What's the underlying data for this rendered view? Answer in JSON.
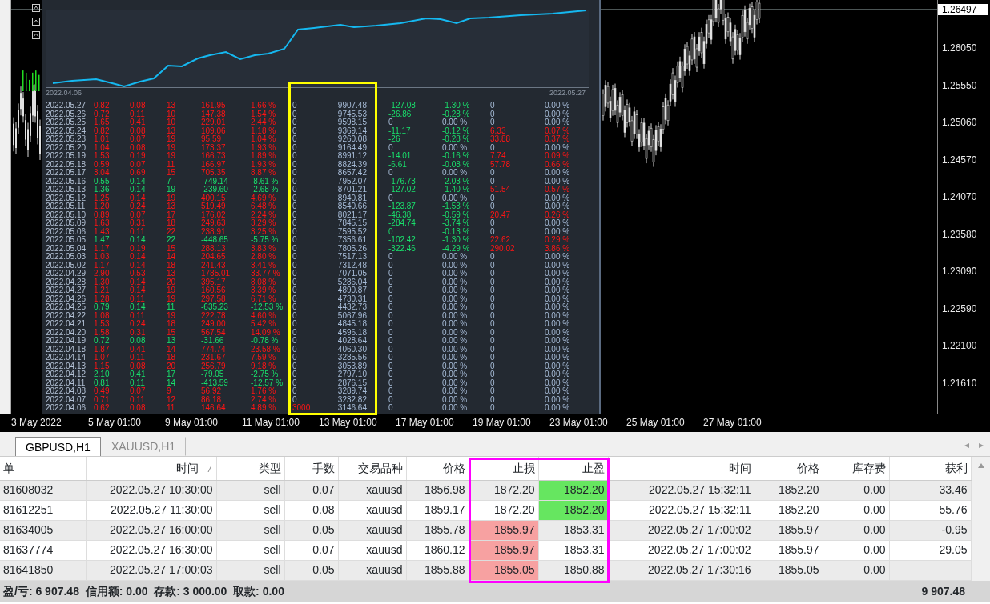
{
  "report": {
    "start_date": "2022.04.06",
    "end_date": "2022.05.27",
    "rows": [
      {
        "cells": [
          "2022.05.27",
          "0.82",
          "0.08",
          "13",
          "161.95",
          "1.66 %",
          "0",
          "9907.48",
          "-127.08",
          "-1.30 %",
          "0",
          "0.00 %"
        ],
        "loss": false,
        "c6_hi": false,
        "c8_hi": true,
        "c10_hi": false
      },
      {
        "cells": [
          "2022.05.26",
          "0.72",
          "0.11",
          "10",
          "147.38",
          "1.54 %",
          "0",
          "9745.53",
          "-26.86",
          "-0.28 %",
          "0",
          "0.00 %"
        ],
        "loss": false,
        "c6_hi": false,
        "c8_hi": true,
        "c10_hi": false
      },
      {
        "cells": [
          "2022.05.25",
          "1.65",
          "0.41",
          "10",
          "229.01",
          "2.44 %",
          "0",
          "9598.15",
          "0",
          "0.00 %",
          "0",
          "0.00 %"
        ],
        "loss": false,
        "c6_hi": false,
        "c8_hi": false,
        "c10_hi": false
      },
      {
        "cells": [
          "2022.05.24",
          "0.82",
          "0.08",
          "13",
          "109.06",
          "1.18 %",
          "0",
          "9369.14",
          "-11.17",
          "-0.12 %",
          "6.33",
          "0.07 %"
        ],
        "loss": false,
        "c6_hi": false,
        "c8_hi": true,
        "c10_hi": true
      },
      {
        "cells": [
          "2022.05.23",
          "1.01",
          "0.07",
          "19",
          "95.59",
          "1.04 %",
          "0",
          "9260.08",
          "-26",
          "-0.28 %",
          "33.88",
          "0.37 %"
        ],
        "loss": false,
        "c6_hi": false,
        "c8_hi": true,
        "c10_hi": true
      },
      {
        "cells": [
          "2022.05.20",
          "1.04",
          "0.08",
          "19",
          "173.37",
          "1.93 %",
          "0",
          "9164.49",
          "0",
          "0.00 %",
          "0",
          "0.00 %"
        ],
        "loss": false,
        "c6_hi": false,
        "c8_hi": false,
        "c10_hi": false
      },
      {
        "cells": [
          "2022.05.19",
          "1.53",
          "0.19",
          "19",
          "166.73",
          "1.89 %",
          "0",
          "8991.12",
          "-14.01",
          "-0.16 %",
          "7.74",
          "0.09 %"
        ],
        "loss": false,
        "c6_hi": false,
        "c8_hi": true,
        "c10_hi": true
      },
      {
        "cells": [
          "2022.05.18",
          "0.59",
          "0.07",
          "11",
          "166.97",
          "1.93 %",
          "0",
          "8824.39",
          "-6.61",
          "-0.08 %",
          "57.78",
          "0.66 %"
        ],
        "loss": false,
        "c6_hi": false,
        "c8_hi": true,
        "c10_hi": true
      },
      {
        "cells": [
          "2022.05.17",
          "3.04",
          "0.69",
          "15",
          "705.35",
          "8.87 %",
          "0",
          "8657.42",
          "0",
          "0.00 %",
          "0",
          "0.00 %"
        ],
        "loss": false,
        "c6_hi": false,
        "c8_hi": false,
        "c10_hi": false
      },
      {
        "cells": [
          "2022.05.16",
          "0.55",
          "0.14",
          "7",
          "-749.14",
          "-8.61 %",
          "0",
          "7952.07",
          "-176.73",
          "-2.03 %",
          "0",
          "0.00 %"
        ],
        "loss": true,
        "c6_hi": false,
        "c8_hi": true,
        "c10_hi": false
      },
      {
        "cells": [
          "2022.05.13",
          "1.36",
          "0.14",
          "19",
          "-239.60",
          "-2.68 %",
          "0",
          "8701.21",
          "-127.02",
          "-1.40 %",
          "51.54",
          "0.57 %"
        ],
        "loss": true,
        "c6_hi": false,
        "c8_hi": true,
        "c10_hi": true
      },
      {
        "cells": [
          "2022.05.12",
          "1.25",
          "0.14",
          "19",
          "400.15",
          "4.69 %",
          "0",
          "8940.81",
          "0",
          "0.00 %",
          "0",
          "0.00 %"
        ],
        "loss": false,
        "c6_hi": false,
        "c8_hi": false,
        "c10_hi": false
      },
      {
        "cells": [
          "2022.05.11",
          "1.20",
          "0.24",
          "13",
          "519.49",
          "6.48 %",
          "0",
          "8540.66",
          "-123.87",
          "-1.53 %",
          "0",
          "0.00 %"
        ],
        "loss": false,
        "c6_hi": false,
        "c8_hi": true,
        "c10_hi": false
      },
      {
        "cells": [
          "2022.05.10",
          "0.89",
          "0.07",
          "17",
          "176.02",
          "2.24 %",
          "0",
          "8021.17",
          "-46.38",
          "-0.59 %",
          "20.47",
          "0.26 %"
        ],
        "loss": false,
        "c6_hi": false,
        "c8_hi": true,
        "c10_hi": true
      },
      {
        "cells": [
          "2022.05.09",
          "1.63",
          "0.31",
          "18",
          "249.63",
          "3.29 %",
          "0",
          "7845.15",
          "-284.74",
          "-3.74 %",
          "0",
          "0.00 %"
        ],
        "loss": false,
        "c6_hi": false,
        "c8_hi": true,
        "c10_hi": false
      },
      {
        "cells": [
          "2022.05.06",
          "1.43",
          "0.11",
          "22",
          "238.91",
          "3.25 %",
          "0",
          "7595.52",
          "0",
          "-0.13 %",
          "0",
          "0.00 %"
        ],
        "loss": false,
        "c6_hi": false,
        "c8_hi": true,
        "c10_hi": false
      },
      {
        "cells": [
          "2022.05.05",
          "1.47",
          "0.14",
          "22",
          "-448.65",
          "-5.75 %",
          "0",
          "7356.61",
          "-102.42",
          "-1.30 %",
          "22.62",
          "0.29 %"
        ],
        "loss": true,
        "c6_hi": false,
        "c8_hi": true,
        "c10_hi": true
      },
      {
        "cells": [
          "2022.05.04",
          "1.17",
          "0.19",
          "15",
          "288.13",
          "3.83 %",
          "0",
          "7805.26",
          "-322.46",
          "-4.29 %",
          "290.02",
          "3.86 %"
        ],
        "loss": false,
        "c6_hi": false,
        "c8_hi": true,
        "c10_hi": true
      },
      {
        "cells": [
          "2022.05.03",
          "1.03",
          "0.14",
          "14",
          "204.65",
          "2.80 %",
          "0",
          "7517.13",
          "0",
          "0.00 %",
          "0",
          "0.00 %"
        ],
        "loss": false,
        "c6_hi": false,
        "c8_hi": false,
        "c10_hi": false
      },
      {
        "cells": [
          "2022.05.02",
          "1.17",
          "0.14",
          "18",
          "241.43",
          "3.41 %",
          "0",
          "7312.48",
          "0",
          "0.00 %",
          "0",
          "0.00 %"
        ],
        "loss": false,
        "c6_hi": false,
        "c8_hi": false,
        "c10_hi": false
      },
      {
        "cells": [
          "2022.04.29",
          "2.90",
          "0.53",
          "13",
          "1785.01",
          "33.77 %",
          "0",
          "7071.05",
          "0",
          "0.00 %",
          "0",
          "0.00 %"
        ],
        "loss": false,
        "c6_hi": false,
        "c8_hi": false,
        "c10_hi": false
      },
      {
        "cells": [
          "2022.04.28",
          "1.30",
          "0.14",
          "20",
          "395.17",
          "8.08 %",
          "0",
          "5286.04",
          "0",
          "0.00 %",
          "0",
          "0.00 %"
        ],
        "loss": false,
        "c6_hi": false,
        "c8_hi": false,
        "c10_hi": false
      },
      {
        "cells": [
          "2022.04.27",
          "1.21",
          "0.14",
          "19",
          "160.56",
          "3.39 %",
          "0",
          "4890.87",
          "0",
          "0.00 %",
          "0",
          "0.00 %"
        ],
        "loss": false,
        "c6_hi": false,
        "c8_hi": false,
        "c10_hi": false
      },
      {
        "cells": [
          "2022.04.26",
          "1.28",
          "0.11",
          "19",
          "297.58",
          "6.71 %",
          "0",
          "4730.31",
          "0",
          "0.00 %",
          "0",
          "0.00 %"
        ],
        "loss": false,
        "c6_hi": false,
        "c8_hi": false,
        "c10_hi": false
      },
      {
        "cells": [
          "2022.04.25",
          "0.79",
          "0.14",
          "11",
          "-635.23",
          "-12.53 %",
          "0",
          "4432.73",
          "0",
          "0.00 %",
          "0",
          "0.00 %"
        ],
        "loss": true,
        "c6_hi": false,
        "c8_hi": false,
        "c10_hi": false
      },
      {
        "cells": [
          "2022.04.22",
          "1.08",
          "0.11",
          "19",
          "222.78",
          "4.60 %",
          "0",
          "5067.96",
          "0",
          "0.00 %",
          "0",
          "0.00 %"
        ],
        "loss": false,
        "c6_hi": false,
        "c8_hi": false,
        "c10_hi": false
      },
      {
        "cells": [
          "2022.04.21",
          "1.53",
          "0.24",
          "18",
          "249.00",
          "5.42 %",
          "0",
          "4845.18",
          "0",
          "0.00 %",
          "0",
          "0.00 %"
        ],
        "loss": false,
        "c6_hi": false,
        "c8_hi": false,
        "c10_hi": false
      },
      {
        "cells": [
          "2022.04.20",
          "1.58",
          "0.31",
          "15",
          "567.54",
          "14.09 %",
          "0",
          "4596.18",
          "0",
          "0.00 %",
          "0",
          "0.00 %"
        ],
        "loss": false,
        "c6_hi": false,
        "c8_hi": false,
        "c10_hi": false
      },
      {
        "cells": [
          "2022.04.19",
          "0.72",
          "0.08",
          "13",
          "-31.66",
          "-0.78 %",
          "0",
          "4028.64",
          "0",
          "0.00 %",
          "0",
          "0.00 %"
        ],
        "loss": true,
        "c6_hi": false,
        "c8_hi": false,
        "c10_hi": false
      },
      {
        "cells": [
          "2022.04.18",
          "1.87",
          "0.41",
          "14",
          "774.74",
          "23.58 %",
          "0",
          "4060.30",
          "0",
          "0.00 %",
          "0",
          "0.00 %"
        ],
        "loss": false,
        "c6_hi": false,
        "c8_hi": false,
        "c10_hi": false
      },
      {
        "cells": [
          "2022.04.14",
          "1.07",
          "0.11",
          "18",
          "231.67",
          "7.59 %",
          "0",
          "3285.56",
          "0",
          "0.00 %",
          "0",
          "0.00 %"
        ],
        "loss": false,
        "c6_hi": false,
        "c8_hi": false,
        "c10_hi": false
      },
      {
        "cells": [
          "2022.04.13",
          "1.15",
          "0.08",
          "20",
          "256.79",
          "9.18 %",
          "0",
          "3053.89",
          "0",
          "0.00 %",
          "0",
          "0.00 %"
        ],
        "loss": false,
        "c6_hi": false,
        "c8_hi": false,
        "c10_hi": false
      },
      {
        "cells": [
          "2022.04.12",
          "2.10",
          "0.41",
          "17",
          "-79.05",
          "-2.75 %",
          "0",
          "2797.10",
          "0",
          "0.00 %",
          "0",
          "0.00 %"
        ],
        "loss": true,
        "c6_hi": false,
        "c8_hi": false,
        "c10_hi": false
      },
      {
        "cells": [
          "2022.04.11",
          "0.81",
          "0.11",
          "14",
          "-413.59",
          "-12.57 %",
          "0",
          "2876.15",
          "0",
          "0.00 %",
          "0",
          "0.00 %"
        ],
        "loss": true,
        "c6_hi": false,
        "c8_hi": false,
        "c10_hi": false
      },
      {
        "cells": [
          "2022.04.08",
          "0.49",
          "0.07",
          "9",
          "56.92",
          "1.76 %",
          "0",
          "3289.74",
          "0",
          "0.00 %",
          "0",
          "0.00 %"
        ],
        "loss": false,
        "c6_hi": false,
        "c8_hi": false,
        "c10_hi": false
      },
      {
        "cells": [
          "2022.04.07",
          "0.71",
          "0.11",
          "12",
          "86.18",
          "2.74 %",
          "0",
          "3232.82",
          "0",
          "0.00 %",
          "0",
          "0.00 %"
        ],
        "loss": false,
        "c6_hi": false,
        "c8_hi": false,
        "c10_hi": false
      },
      {
        "cells": [
          "2022.04.06",
          "0.62",
          "0.08",
          "11",
          "146.64",
          "4.89 %",
          "3000",
          "3146.64",
          "0",
          "0.00 %",
          "0",
          "0.00 %"
        ],
        "loss": false,
        "c6_hi": true,
        "c8_hi": false,
        "c10_hi": false
      }
    ]
  },
  "price_axis": {
    "current_price": "1.26497",
    "labels": [
      "1.26050",
      "1.25550",
      "1.25060",
      "1.24570",
      "1.24070",
      "1.23580",
      "1.23090",
      "1.22590",
      "1.22100",
      "1.21610"
    ]
  },
  "time_axis": [
    "3 May 2022",
    "5 May 01:00",
    "9 May 01:00",
    "11 May 01:00",
    "13 May 01:00",
    "17 May 01:00",
    "19 May 01:00",
    "23 May 01:00",
    "25 May 01:00",
    "27 May 01:00"
  ],
  "tabs": [
    {
      "label": "GBPUSD,H1",
      "selected": true
    },
    {
      "label": "XAUUSD,H1",
      "selected": false
    }
  ],
  "tab_scroll": {
    "left": "◂",
    "right": "▸"
  },
  "orders": {
    "columns": [
      {
        "label": "单",
        "sorted": false
      },
      {
        "label": "时间",
        "sorted": true
      },
      {
        "label": "类型",
        "sorted": false
      },
      {
        "label": "手数",
        "sorted": false
      },
      {
        "label": "交易品种",
        "sorted": false
      },
      {
        "label": "价格",
        "sorted": false
      },
      {
        "label": "止损",
        "sorted": false
      },
      {
        "label": "止盈",
        "sorted": false
      },
      {
        "label": "时间",
        "sorted": false
      },
      {
        "label": "价格",
        "sorted": false
      },
      {
        "label": "库存费",
        "sorted": false
      },
      {
        "label": "获利",
        "sorted": false
      }
    ],
    "rows": [
      {
        "cells": [
          "81608032",
          "2022.05.27 10:30:00",
          "sell",
          "0.07",
          "xauusd",
          "1856.98",
          "1872.20",
          "1852.20",
          "2022.05.27 15:32:11",
          "1852.20",
          "0.00",
          "33.46"
        ],
        "sl_hit": false,
        "tp_hit": true
      },
      {
        "cells": [
          "81612251",
          "2022.05.27 11:30:00",
          "sell",
          "0.08",
          "xauusd",
          "1859.17",
          "1872.20",
          "1852.20",
          "2022.05.27 15:32:11",
          "1852.20",
          "0.00",
          "55.76"
        ],
        "sl_hit": false,
        "tp_hit": true
      },
      {
        "cells": [
          "81634005",
          "2022.05.27 16:00:00",
          "sell",
          "0.05",
          "xauusd",
          "1855.78",
          "1855.97",
          "1853.31",
          "2022.05.27 17:00:02",
          "1855.97",
          "0.00",
          "-0.95"
        ],
        "sl_hit": true,
        "tp_hit": false
      },
      {
        "cells": [
          "81637774",
          "2022.05.27 16:30:00",
          "sell",
          "0.07",
          "xauusd",
          "1860.12",
          "1855.97",
          "1853.31",
          "2022.05.27 17:00:02",
          "1855.97",
          "0.00",
          "29.05"
        ],
        "sl_hit": true,
        "tp_hit": false
      },
      {
        "cells": [
          "81641850",
          "2022.05.27 17:00:03",
          "sell",
          "0.05",
          "xauusd",
          "1855.88",
          "1855.05",
          "1850.88",
          "2022.05.27 17:30:16",
          "1855.05",
          "0.00"
        ],
        "sl_hit": true,
        "tp_hit": false
      }
    ]
  },
  "summary": {
    "text": "盈/亏: 6 907.48  信用额: 0.00  存款: 3 000.00  取款: 0.00",
    "total": "9 907.48"
  }
}
